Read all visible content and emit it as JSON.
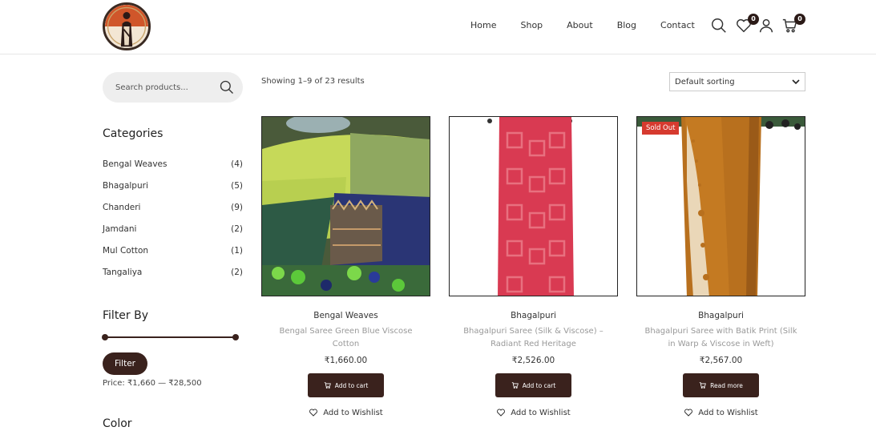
{
  "nav": {
    "items": [
      "Home",
      "Shop",
      "About",
      "Blog",
      "Contact"
    ]
  },
  "header_icons": {
    "wishlist_count": "0",
    "cart_count": "0"
  },
  "sidebar": {
    "search_placeholder": "Search products...",
    "categories_title": "Categories",
    "categories": [
      {
        "name": "Bengal Weaves",
        "count": "(4)"
      },
      {
        "name": "Bhagalpuri",
        "count": "(5)"
      },
      {
        "name": "Chanderi",
        "count": "(9)"
      },
      {
        "name": "Jamdani",
        "count": "(2)"
      },
      {
        "name": "Mul Cotton",
        "count": "(1)"
      },
      {
        "name": "Tangaliya",
        "count": "(2)"
      }
    ],
    "filter_title": "Filter By",
    "filter_button": "Filter",
    "price_range": "Price: ₹1,660 — ₹28,500",
    "color_title": "Color"
  },
  "toolbar": {
    "results": "Showing 1–9 of 23 results",
    "sort_selected": "Default sorting"
  },
  "products": [
    {
      "category": "Bengal Weaves",
      "name": "Bengal Saree Green Blue Viscose Cotton",
      "price": "₹1,660.00",
      "button": "Add to cart",
      "wishlist": "Add to Wishlist",
      "badge": ""
    },
    {
      "category": "Bhagalpuri",
      "name": "Bhagalpuri Saree (Silk & Viscose) – Radiant Red Heritage",
      "price": "₹2,526.00",
      "button": "Add to cart",
      "wishlist": "Add to Wishlist",
      "badge": ""
    },
    {
      "category": "Bhagalpuri",
      "name": "Bhagalpuri Saree with Batik Print (Silk in Warp & Viscose in Weft)",
      "price": "₹2,567.00",
      "button": "Read more",
      "wishlist": "Add to Wishlist",
      "badge": "Sold Out"
    }
  ],
  "colors": {
    "accent": "#3a221d",
    "sold_badge": "#d63a2f"
  }
}
